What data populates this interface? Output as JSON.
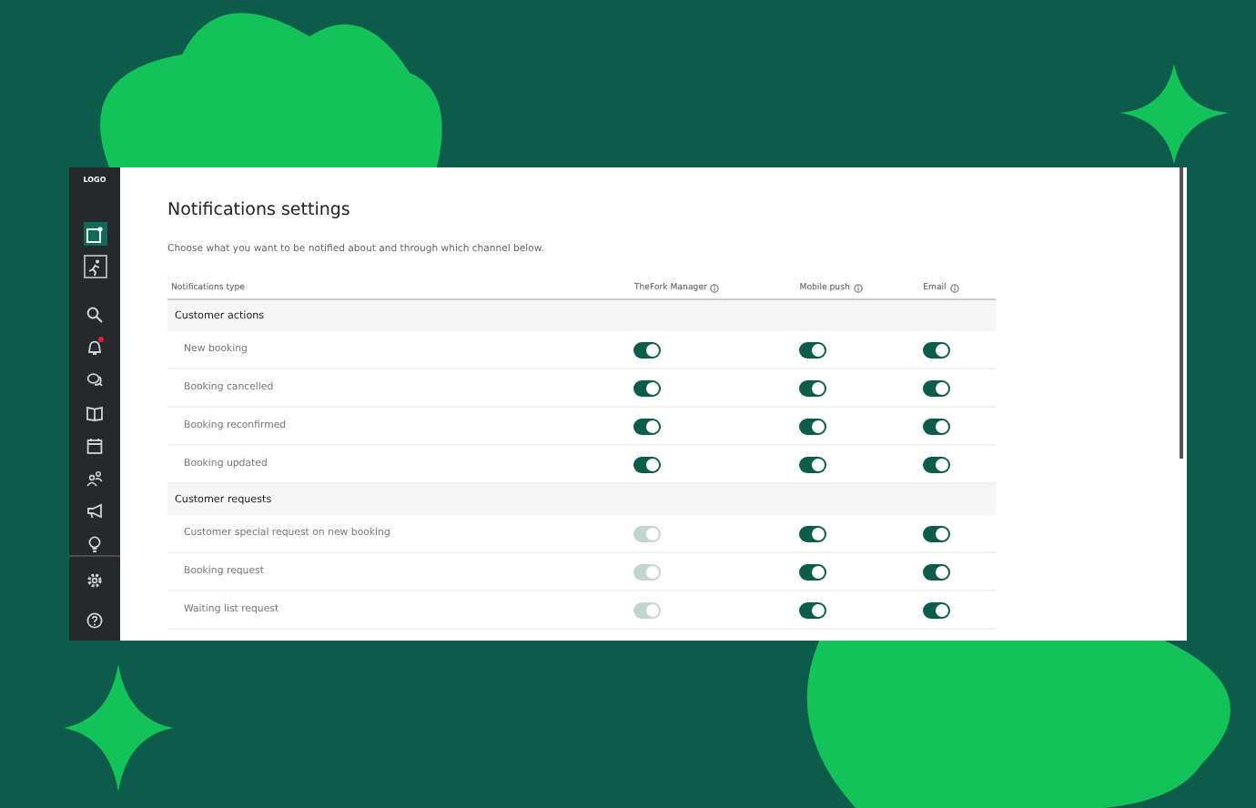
{
  "sidebar": {
    "logo": "LOGO",
    "items": [
      {
        "selected": true
      },
      {
        "selected": false
      },
      {
        "selected": false
      },
      {
        "selected": false,
        "badge": true
      },
      {
        "selected": false
      },
      {
        "selected": false
      },
      {
        "selected": false
      },
      {
        "selected": false
      },
      {
        "selected": false
      },
      {
        "selected": false
      }
    ],
    "bottom_items": [
      {
        "selected": false
      },
      {
        "selected": false
      }
    ]
  },
  "page": {
    "title": "Notifications settings",
    "description": "Choose what you want to be notified about and through which channel below."
  },
  "table": {
    "columns": [
      {
        "label": "Notifications type",
        "info": false
      },
      {
        "label": "TheFork Manager",
        "info": true
      },
      {
        "label": "Mobile push",
        "info": true
      },
      {
        "label": "Email",
        "info": true
      }
    ],
    "sections": [
      {
        "title": "Customer actions",
        "rows": [
          {
            "label": "New booking",
            "toggles": [
              {
                "on": true,
                "disabled": false
              },
              {
                "on": true,
                "disabled": false
              },
              {
                "on": true,
                "disabled": false
              }
            ]
          },
          {
            "label": "Booking cancelled",
            "toggles": [
              {
                "on": true,
                "disabled": false
              },
              {
                "on": true,
                "disabled": false
              },
              {
                "on": true,
                "disabled": false
              }
            ]
          },
          {
            "label": "Booking reconfirmed",
            "toggles": [
              {
                "on": true,
                "disabled": false
              },
              {
                "on": true,
                "disabled": false
              },
              {
                "on": true,
                "disabled": false
              }
            ]
          },
          {
            "label": "Booking updated",
            "toggles": [
              {
                "on": true,
                "disabled": false
              },
              {
                "on": true,
                "disabled": false
              },
              {
                "on": true,
                "disabled": false
              }
            ]
          }
        ]
      },
      {
        "title": "Customer requests",
        "rows": [
          {
            "label": "Customer special request on new booking",
            "toggles": [
              {
                "on": true,
                "disabled": true
              },
              {
                "on": true,
                "disabled": false
              },
              {
                "on": true,
                "disabled": false
              }
            ]
          },
          {
            "label": "Booking request",
            "toggles": [
              {
                "on": true,
                "disabled": true
              },
              {
                "on": true,
                "disabled": false
              },
              {
                "on": true,
                "disabled": false
              }
            ]
          },
          {
            "label": "Waiting list request",
            "toggles": [
              {
                "on": true,
                "disabled": true
              },
              {
                "on": true,
                "disabled": false
              },
              {
                "on": true,
                "disabled": false
              }
            ]
          }
        ]
      }
    ]
  }
}
